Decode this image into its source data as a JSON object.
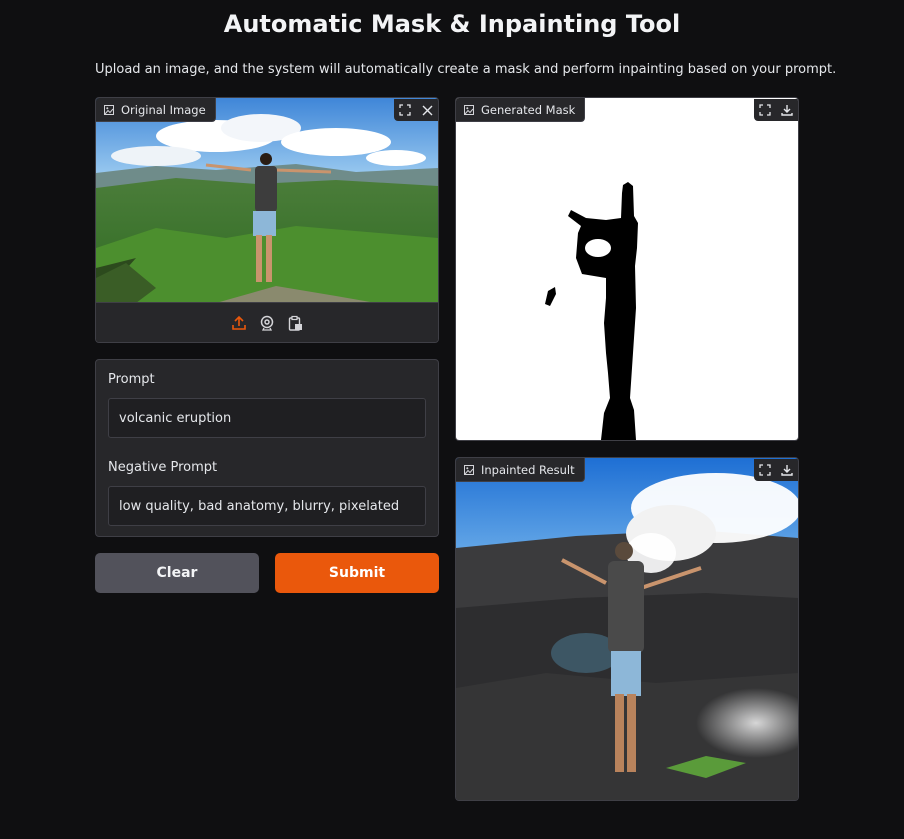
{
  "app": {
    "title": "Automatic Mask & Inpainting Tool",
    "description": "Upload an image, and the system will automatically create a mask and perform inpainting based on your prompt."
  },
  "original_image": {
    "label": "Original Image",
    "icons": [
      "image-icon",
      "fullscreen-icon",
      "close-icon",
      "upload-icon",
      "webcam-icon",
      "clipboard-icon"
    ]
  },
  "generated_mask": {
    "label": "Generated Mask",
    "icons": [
      "image-icon",
      "fullscreen-icon",
      "download-icon"
    ]
  },
  "inpainted_result": {
    "label": "Inpainted Result",
    "icons": [
      "image-icon",
      "fullscreen-icon",
      "download-icon"
    ]
  },
  "form": {
    "prompt_label": "Prompt",
    "prompt_value": "volcanic eruption",
    "negative_label": "Negative Prompt",
    "negative_value": "low quality, bad anatomy, blurry, pixelated"
  },
  "buttons": {
    "clear": "Clear",
    "submit": "Submit"
  },
  "colors": {
    "accent": "#ea580c",
    "background": "#0f0f11",
    "panel": "#27272a"
  }
}
